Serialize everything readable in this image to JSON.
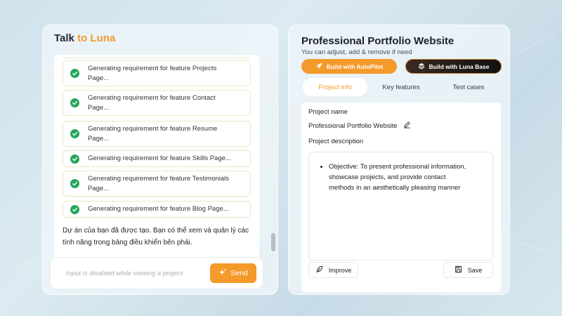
{
  "left": {
    "title_prefix": "Talk ",
    "title_accent": "to Luna",
    "features": [
      {
        "line1": "Generating requirement for feature Projects",
        "line2": "Page..."
      },
      {
        "line1": "Generating requirement for feature Contact",
        "line2": "Page..."
      },
      {
        "line1": "Generating requirement for feature Resume",
        "line2": "Page..."
      },
      {
        "line1": "Generating requirement for feature Skills Page...",
        "line2": ""
      },
      {
        "line1": "Generating requirement for feature Testimonials",
        "line2": "Page..."
      },
      {
        "line1": "Generating requirement for feature Blog Page...",
        "line2": ""
      }
    ],
    "message": "Dự án của bạn đã được tạo. Bạn có thể xem và quản lý các tính năng trong bảng điều khiển bên phải.",
    "input_placeholder": "Input is disabled while viewing a project",
    "send_label": "Send"
  },
  "right": {
    "title": "Professional Portfolio Website",
    "subtitle": "You can adjust, add & remove if need",
    "btn_autopilot": "Build with AutoPilot",
    "btn_lunabase": "Build with Luna Base",
    "tabs": [
      "Project info",
      "Key features",
      "Test cases"
    ],
    "label_name": "Project name",
    "project_name": "Professional Portfolio Website",
    "label_desc": "Project description",
    "description": "Objective: To present professional information, showcase projects, and provide contact methods in an aesthetically pleasing manner",
    "btn_improve": "Improve",
    "btn_save": "Save"
  },
  "colors": {
    "accent": "#f39a2b",
    "check": "#26a65b"
  }
}
